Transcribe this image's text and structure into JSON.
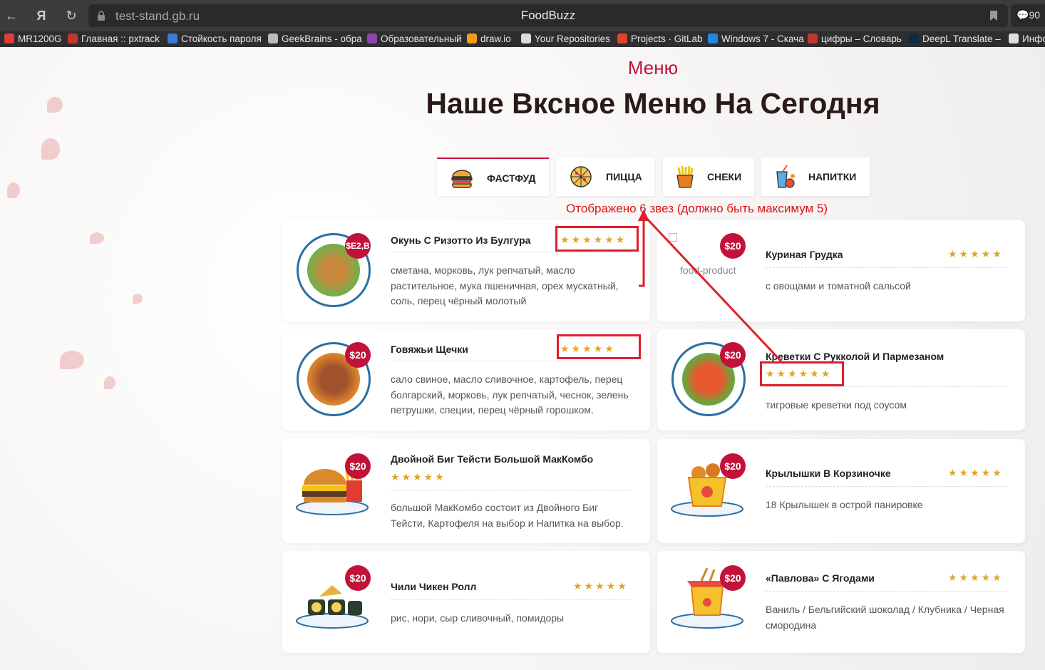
{
  "browser": {
    "url": "test-stand.gb.ru",
    "title": "FoodBuzz",
    "extension_badge": "90",
    "bookmarks": [
      {
        "label": "MR1200G",
        "color": "#e23b3b"
      },
      {
        "label": "Главная :: pxtrack",
        "color": "#c0392b"
      },
      {
        "label": "Стойкость пароля",
        "color": "#3a7bd5"
      },
      {
        "label": "GeekBrains - обра",
        "color": "#bbbbbb"
      },
      {
        "label": "Образовательный",
        "color": "#8e44ad"
      },
      {
        "label": "draw.io",
        "color": "#f39c12"
      },
      {
        "label": "Your Repositories",
        "color": "#dddddd"
      },
      {
        "label": "Projects · GitLab",
        "color": "#e2432a"
      },
      {
        "label": "Windows 7 - Скача",
        "color": "#1e88e5"
      },
      {
        "label": "цифры – Словарь",
        "color": "#c0392b"
      },
      {
        "label": "DeepL Translate –",
        "color": "#0f2b46"
      },
      {
        "label": "Инфо",
        "color": "#dddddd"
      }
    ]
  },
  "page": {
    "section_label": "Меню",
    "heading": "Наше Вксное Меню На Сегодня",
    "tabs": [
      {
        "label": "ФАСТФУД",
        "icon": "burger-icon"
      },
      {
        "label": "ПИЦЦА",
        "icon": "pizza-icon"
      },
      {
        "label": "СНЕКИ",
        "icon": "fries-icon"
      },
      {
        "label": "НАПИТКИ",
        "icon": "drinks-icon"
      }
    ],
    "annotation": "Отображено 6 звез (должно быть максимум 5)",
    "broken_image_alt": "food-product",
    "dishes": [
      {
        "name": "Окунь С Ризотто Из Булгура",
        "price": "$E2,B",
        "stars": "★★★★★★",
        "rating": 6,
        "description": "сметана, морковь, лук репчатый, масло растительное, мука пшеничная, орех мускатный, соль, перец чёрный молотый"
      },
      {
        "name": "Куриная Грудка",
        "price": "$20",
        "stars": "★★★★★",
        "rating": 5,
        "description": "с овощами и томатной сальсой"
      },
      {
        "name": "Говяжьи Щечки",
        "price": "$20",
        "stars": "★★★★★",
        "rating": 5,
        "description": "сало свиное, масло сливочное, картофель, перец болгарский, морковь, лук репчатый, чеснок, зелень петрушки, специи, перец чёрный горошком."
      },
      {
        "name": "Креветки С Рукколой И Пармезаном",
        "price": "$20",
        "stars": "★★★★★★",
        "rating": 6,
        "description": "тигровые креветки под соусом"
      },
      {
        "name": "Двойной Биг Тейсти Большой МакКомбо",
        "price": "$20",
        "stars": "★★★★★",
        "rating": 5,
        "description": "большой МакКомбо состоит из Двойного Биг Тейсти, Картофеля на выбор и Напитка на выбор."
      },
      {
        "name": "Крылышки В Корзиночке",
        "price": "$20",
        "stars": "★★★★★",
        "rating": 5,
        "description": "18 Крылышек в острой панировке"
      },
      {
        "name": "Чили Чикен Ролл",
        "price": "$20",
        "stars": "★★★★★",
        "rating": 5,
        "description": "рис, нори, сыр сливочный, помидоры"
      },
      {
        "name": "«Павлова» С Ягодами",
        "price": "$20",
        "stars": "★★★★★",
        "rating": 5,
        "description": "Ваниль / Бельгийский шоколад / Клубника / Черная смородина"
      }
    ]
  },
  "colors": {
    "accent": "#c2123a",
    "star": "#e0a526",
    "annotation": "#e11d2b"
  }
}
